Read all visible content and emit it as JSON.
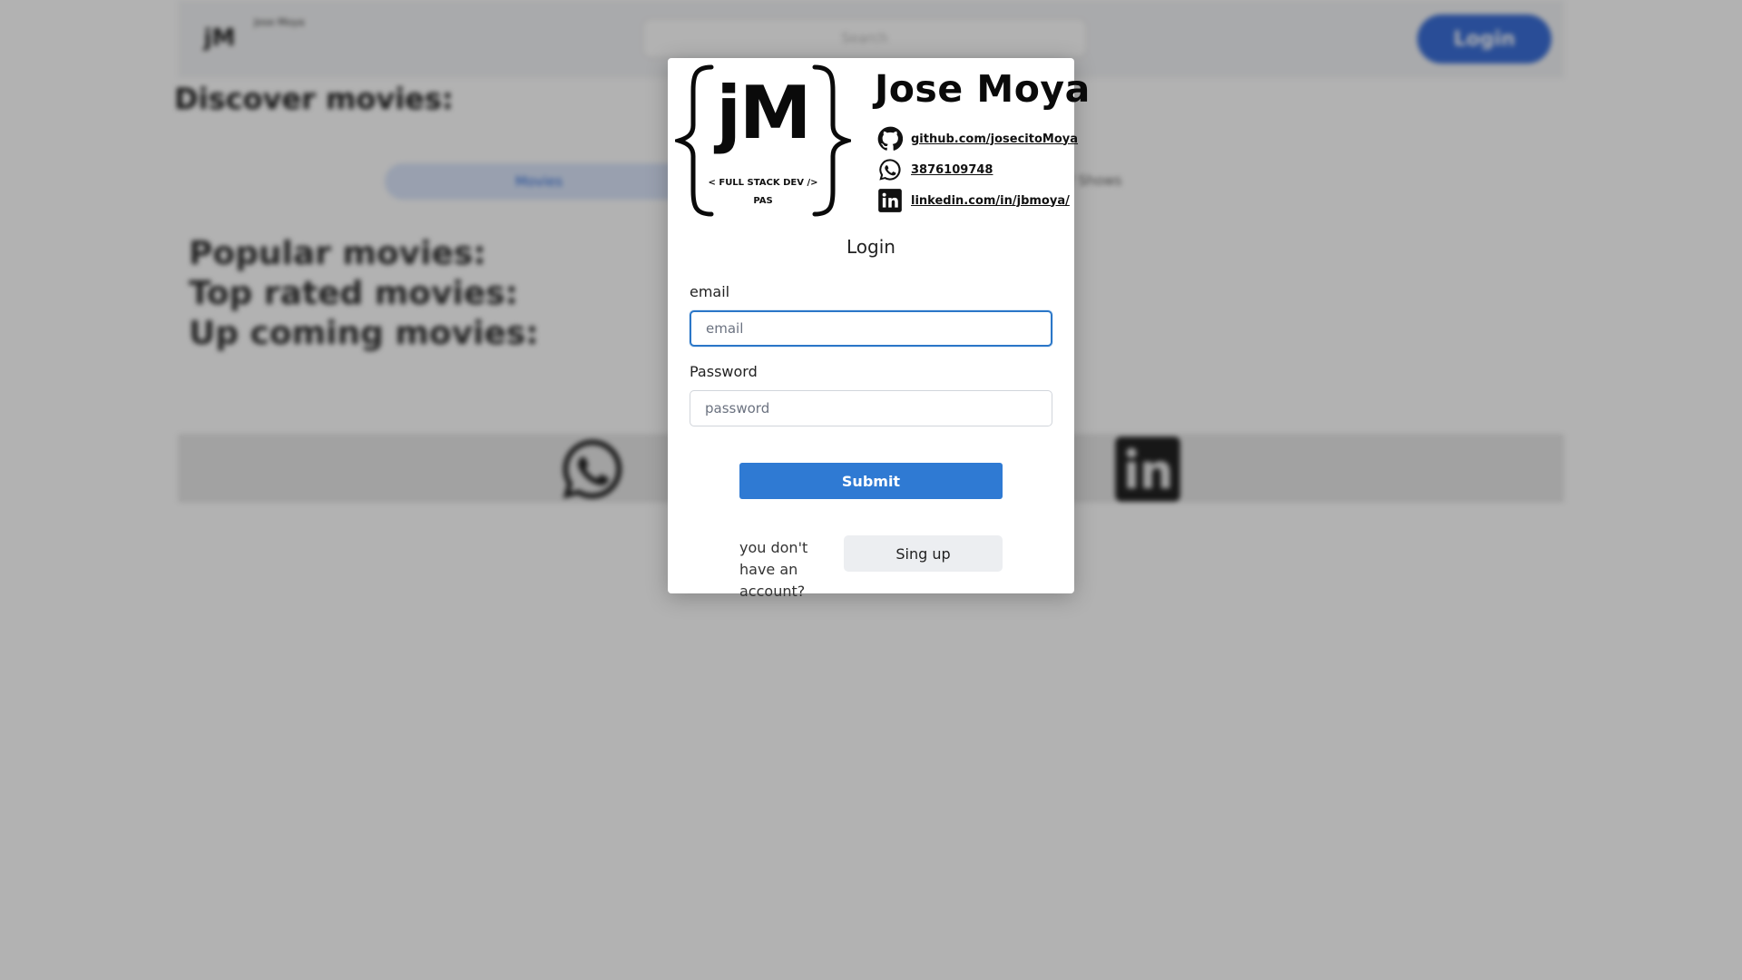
{
  "background": {
    "brand_mini": "jM",
    "brand_name": "Jose Moya",
    "search_placeholder": "Search",
    "login_button": "Login",
    "heading": "Discover movies:",
    "tab_active": "Movies",
    "tab_other": "TV Shows",
    "sections": [
      "Popular movies:",
      "Top rated movies:",
      "Up coming movies:"
    ]
  },
  "brand": {
    "logo_text": "jM",
    "tagline": "< FULL STACK DEV />",
    "tagline2": "PAS",
    "name": "Jose Moya",
    "contacts": [
      {
        "icon": "github-icon",
        "text": "github.com/josecitoMoya"
      },
      {
        "icon": "whatsapp-icon",
        "text": "3876109748"
      },
      {
        "icon": "linkedin-icon",
        "text": "linkedin.com/in/jbmoya/"
      }
    ]
  },
  "form": {
    "title": "Login",
    "email_label": "email",
    "email_placeholder": "email",
    "password_label": "Password",
    "password_placeholder": "password",
    "submit_label": "Submit",
    "no_account_text": "you don't have an account?",
    "signup_label": "Sing up"
  },
  "colors": {
    "primary": "#2f7ad3",
    "focus_border": "#2b77c8",
    "overlay": "rgba(0,0,0,0.30)"
  }
}
